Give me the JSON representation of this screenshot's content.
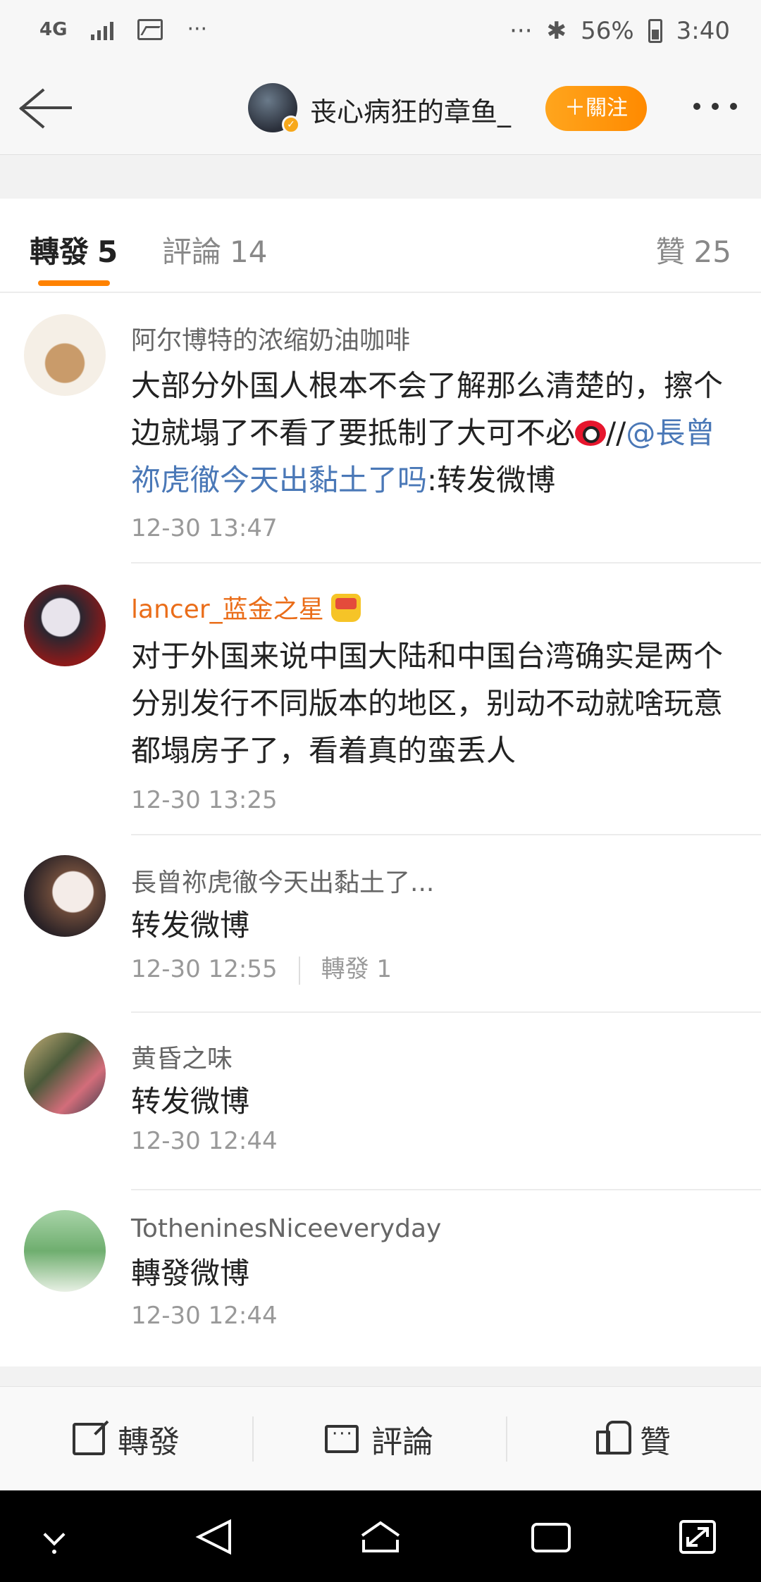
{
  "status_bar": {
    "network": "4G",
    "dots_left": "···",
    "dots_right": "···",
    "battery": "56%",
    "time": "3:40"
  },
  "header": {
    "title": "丧心病狂的章鱼_",
    "follow_label": "＋關注"
  },
  "tabs": [
    {
      "label": "轉發",
      "count": "5"
    },
    {
      "label": "評論",
      "count": "14"
    },
    {
      "label": "贊",
      "count": "25"
    }
  ],
  "items": [
    {
      "name": "阿尔博特的浓缩奶油咖啡",
      "text_before": "大部分外国人根本不会了解那么清楚的，擦个边就塌了不看了要抵制了大可不必",
      "text_slashes": "//",
      "mention": "@長曾祢虎徹今天出黏土了吗",
      "text_after": ":转发微博",
      "time": "12-30 13:47"
    },
    {
      "name": "lancer_蓝金之星",
      "text": "对于外国来说中国大陆和中国台湾确实是两个分别发行不同版本的地区，别动不动就啥玩意都塌房子了，看着真的蛮丢人",
      "time": "12-30 13:25"
    },
    {
      "name": "長曾祢虎徹今天出黏土了...",
      "text": "转发微博",
      "time": "12-30 12:55",
      "reposts": "轉發 1"
    },
    {
      "name": "黄昏之味",
      "text": "转发微博",
      "time": "12-30 12:44"
    },
    {
      "name": "TotheninesNiceeveryday",
      "text": "轉發微博",
      "time": "12-30 12:44"
    }
  ],
  "action_bar": {
    "repost": "轉發",
    "comment": "評論",
    "like": "贊"
  }
}
